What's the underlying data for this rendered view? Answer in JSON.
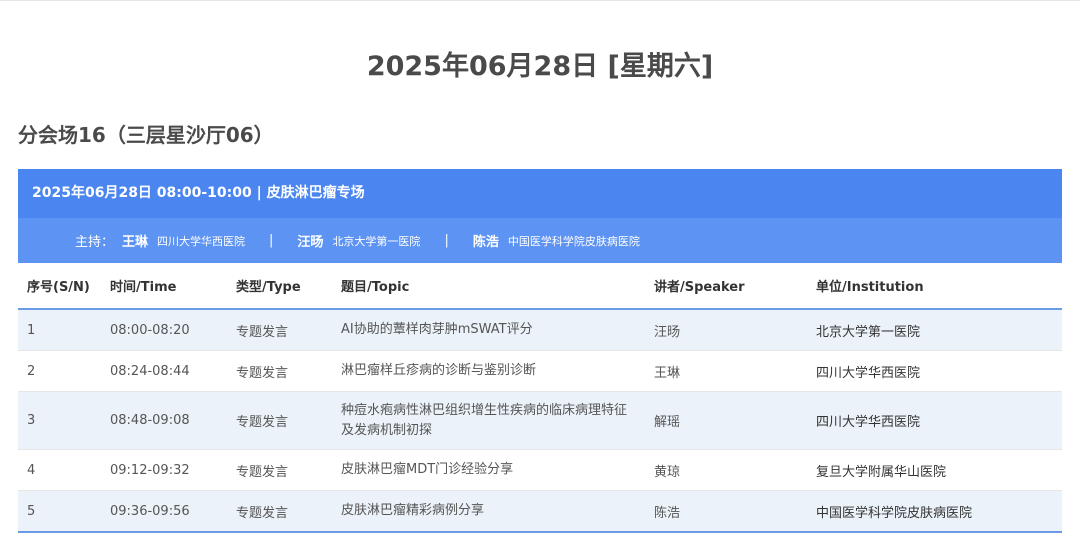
{
  "date_title": "2025年06月28日 [星期六]",
  "venue_title": "分会场16（三层星沙厅06）",
  "session": {
    "header": "2025年06月28日 08:00-10:00 | 皮肤淋巴瘤专场",
    "hosts_label": "主持：",
    "hosts": [
      {
        "name": "王琳",
        "institution": "四川大学华西医院"
      },
      {
        "name": "汪旸",
        "institution": "北京大学第一医院"
      },
      {
        "name": "陈浩",
        "institution": "中国医学科学院皮肤病医院"
      }
    ],
    "separator": "|"
  },
  "table": {
    "headers": [
      "序号(S/N)",
      "时间/Time",
      "类型/Type",
      "题目/Topic",
      "讲者/Speaker",
      "单位/Institution"
    ],
    "rows": [
      {
        "sn": "1",
        "time": "08:00-08:20",
        "type": "专题发言",
        "topic": "AI协助的蕈样肉芽肿mSWAT评分",
        "speaker": "汪旸",
        "institution": "北京大学第一医院"
      },
      {
        "sn": "2",
        "time": "08:24-08:44",
        "type": "专题发言",
        "topic": "淋巴瘤样丘疹病的诊断与鉴别诊断",
        "speaker": "王琳",
        "institution": "四川大学华西医院"
      },
      {
        "sn": "3",
        "time": "08:48-09:08",
        "type": "专题发言",
        "topic": "种痘水疱病性淋巴组织增生性疾病的临床病理特征及发病机制初探",
        "speaker": "解瑶",
        "institution": "四川大学华西医院"
      },
      {
        "sn": "4",
        "time": "09:12-09:32",
        "type": "专题发言",
        "topic": "皮肤淋巴瘤MDT门诊经验分享",
        "speaker": "黄琼",
        "institution": "复旦大学附属华山医院"
      },
      {
        "sn": "5",
        "time": "09:36-09:56",
        "type": "专题发言",
        "topic": "皮肤淋巴瘤精彩病例分享",
        "speaker": "陈浩",
        "institution": "中国医学科学院皮肤病医院"
      }
    ]
  }
}
